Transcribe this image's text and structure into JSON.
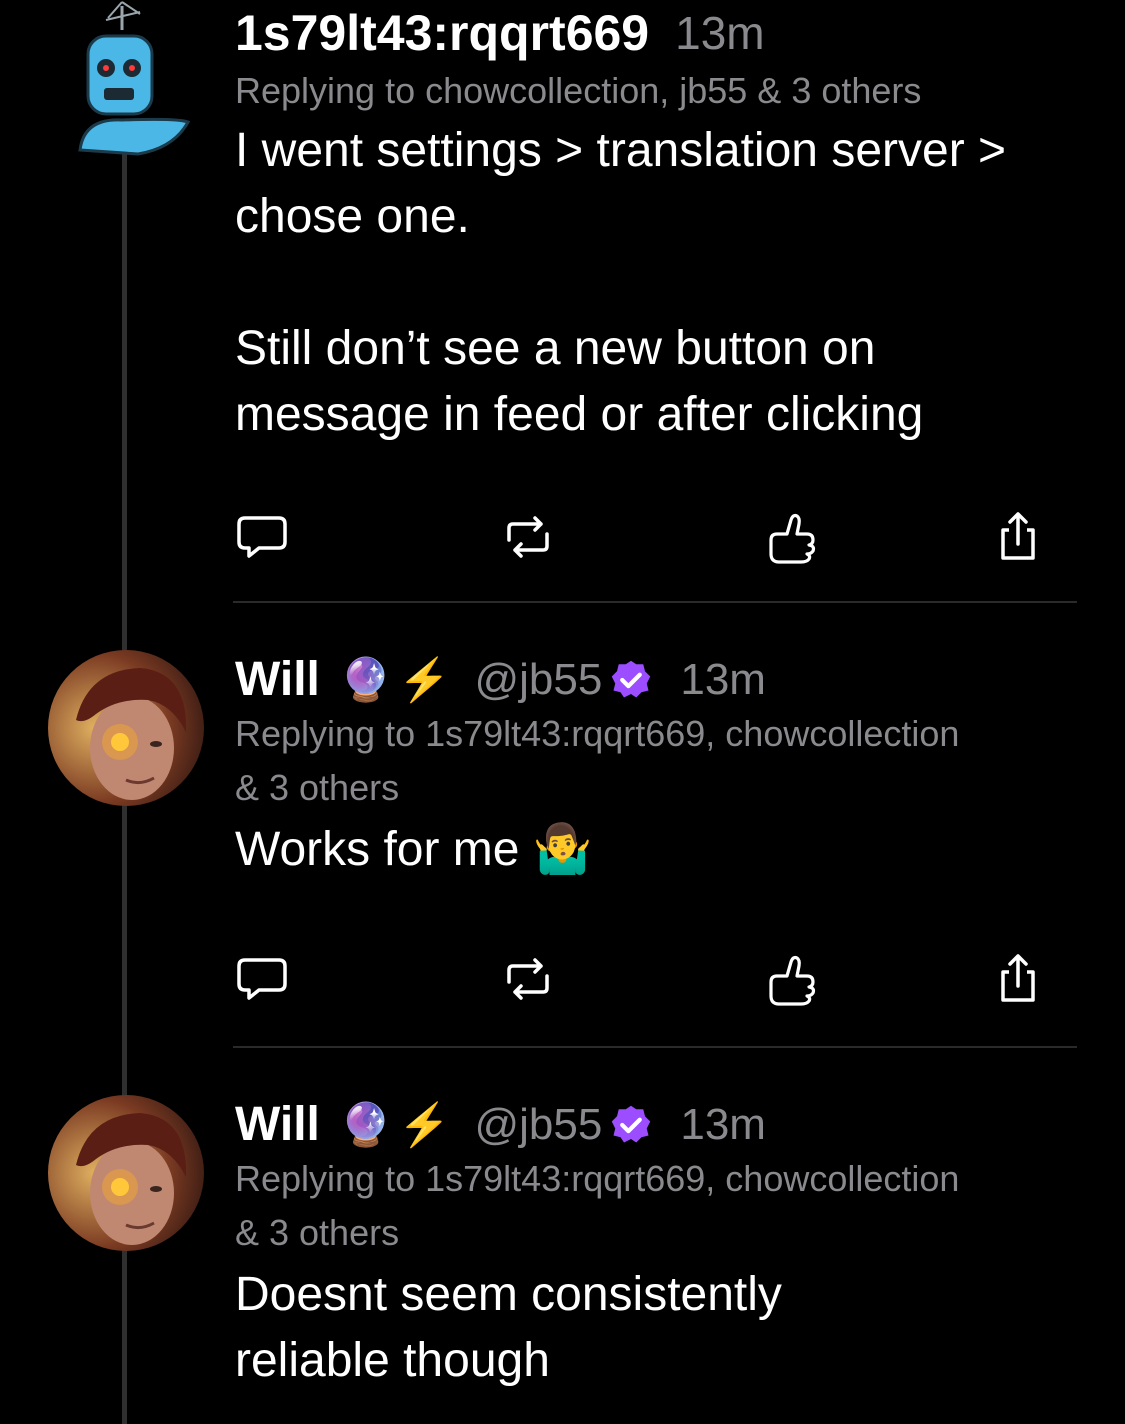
{
  "posts": [
    {
      "author": "1s79lt43:rqqrt669",
      "time": "13m",
      "replying": "Replying to chowcollection, jb55 & 3 others",
      "body_lines": [
        "I went settings > translation server >",
        "chose one.",
        "",
        "Still don’t see a new button on",
        "message in feed or after clicking"
      ],
      "avatar_icon": "robot-avatar-icon"
    },
    {
      "author": "Will",
      "emojis": [
        "🔮",
        "⚡"
      ],
      "handle": "@jb55",
      "verified_color": "#9b4dff",
      "time": "13m",
      "replying_lines": [
        "Replying to 1s79lt43:rqqrt669, chowcollection",
        "& 3 others"
      ],
      "body": "Works for me 🤷‍♂️"
    },
    {
      "author": "Will",
      "emojis": [
        "🔮",
        "⚡"
      ],
      "handle": "@jb55",
      "verified_color": "#9b4dff",
      "time": "13m",
      "replying_lines": [
        "Replying to 1s79lt43:rqqrt669, chowcollection",
        "& 3 others"
      ],
      "body_lines": [
        "Doesnt seem consistently",
        "reliable though"
      ]
    }
  ],
  "actions": [
    "reply-icon",
    "repost-icon",
    "like-icon",
    "share-icon"
  ],
  "colors": {
    "background": "#000000",
    "text": "#ffffff",
    "muted": "#8a8a8e",
    "verified": "#9b4dff"
  }
}
